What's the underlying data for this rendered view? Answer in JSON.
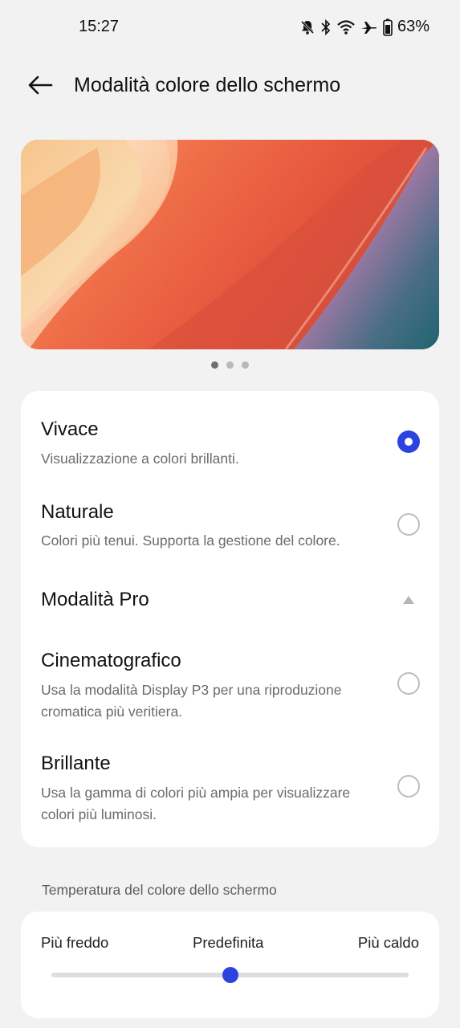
{
  "status_bar": {
    "time": "15:27",
    "icons": [
      "bell-muted-icon",
      "bluetooth-icon",
      "wifi-icon",
      "airplane-icon",
      "battery-icon"
    ],
    "battery_percent": "63%"
  },
  "header": {
    "back_icon": "arrow-left-icon",
    "title": "Modalità colore dello schermo"
  },
  "carousel": {
    "page_count": 3,
    "current_page": 1
  },
  "options": [
    {
      "title": "Vivace",
      "description": "Visualizzazione a colori brillanti.",
      "selected": true
    },
    {
      "title": "Naturale",
      "description": "Colori più tenui. Supporta la gestione del colore.",
      "selected": false
    }
  ],
  "pro_section": {
    "title": "Modalità Pro",
    "expanded": true,
    "toggle_icon": "triangle-up-icon",
    "options": [
      {
        "title": "Cinematografico",
        "description": "Usa la modalità Display P3 per una riproduzione cromatica più veritiera.",
        "selected": false
      },
      {
        "title": "Brillante",
        "description": "Usa la gamma di colori più ampia per visualizzare colori più luminosi.",
        "selected": false
      }
    ]
  },
  "temperature": {
    "section_label": "Temperatura del colore dello schermo",
    "left_label": "Più freddo",
    "center_label": "Predefinita",
    "right_label": "Più caldo",
    "value_fraction": 0.5
  },
  "colors": {
    "accent": "#2c43e0",
    "background": "#f2f2f2",
    "card": "#ffffff"
  }
}
